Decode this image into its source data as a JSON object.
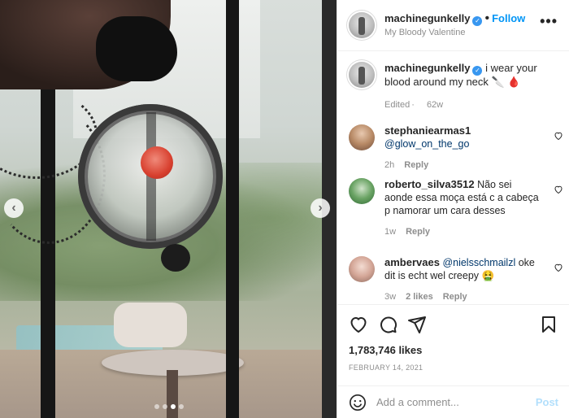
{
  "post": {
    "username": "machinegunkelly",
    "follow_label": "Follow",
    "separator": "•",
    "location": "My Bloody Valentine",
    "more_label": "•••",
    "nav_prev": "‹",
    "nav_next": "›",
    "carousel_dots": 4,
    "carousel_active_dot": 2
  },
  "caption": {
    "username": "machinegunkelly",
    "text": "i wear your blood around my neck 🔪 🩸",
    "edited": "Edited",
    "age": "62w"
  },
  "comments": [
    {
      "username": "stephaniearmas1",
      "text": "@glow_on_the_go",
      "age": "2h",
      "reply_label": "Reply"
    },
    {
      "username": "roberto_silva3512",
      "text": "Não sei aonde essa moça está c a cabeça p namorar um cara desses",
      "age": "1w",
      "reply_label": "Reply"
    },
    {
      "username": "ambervaes",
      "mention": "@nielsschmailzl",
      "text": "oke dit is echt wel creepy 🤮",
      "age": "3w",
      "likes_label": "2 likes",
      "reply_label": "Reply"
    }
  ],
  "actions": {
    "likes": "1,783,746 likes",
    "date": "FEBRUARY 14, 2021"
  },
  "add_comment": {
    "placeholder": "Add a comment...",
    "post_label": "Post"
  },
  "colors": {
    "accent": "#0095f6",
    "verified": "#3897f0",
    "muted": "#8e8e8e",
    "post_disabled": "#b2dffc"
  },
  "icons": [
    "heart-icon",
    "comment-icon",
    "share-icon",
    "bookmark-icon",
    "emoji-icon",
    "verified-badge-icon",
    "more-options-icon"
  ]
}
